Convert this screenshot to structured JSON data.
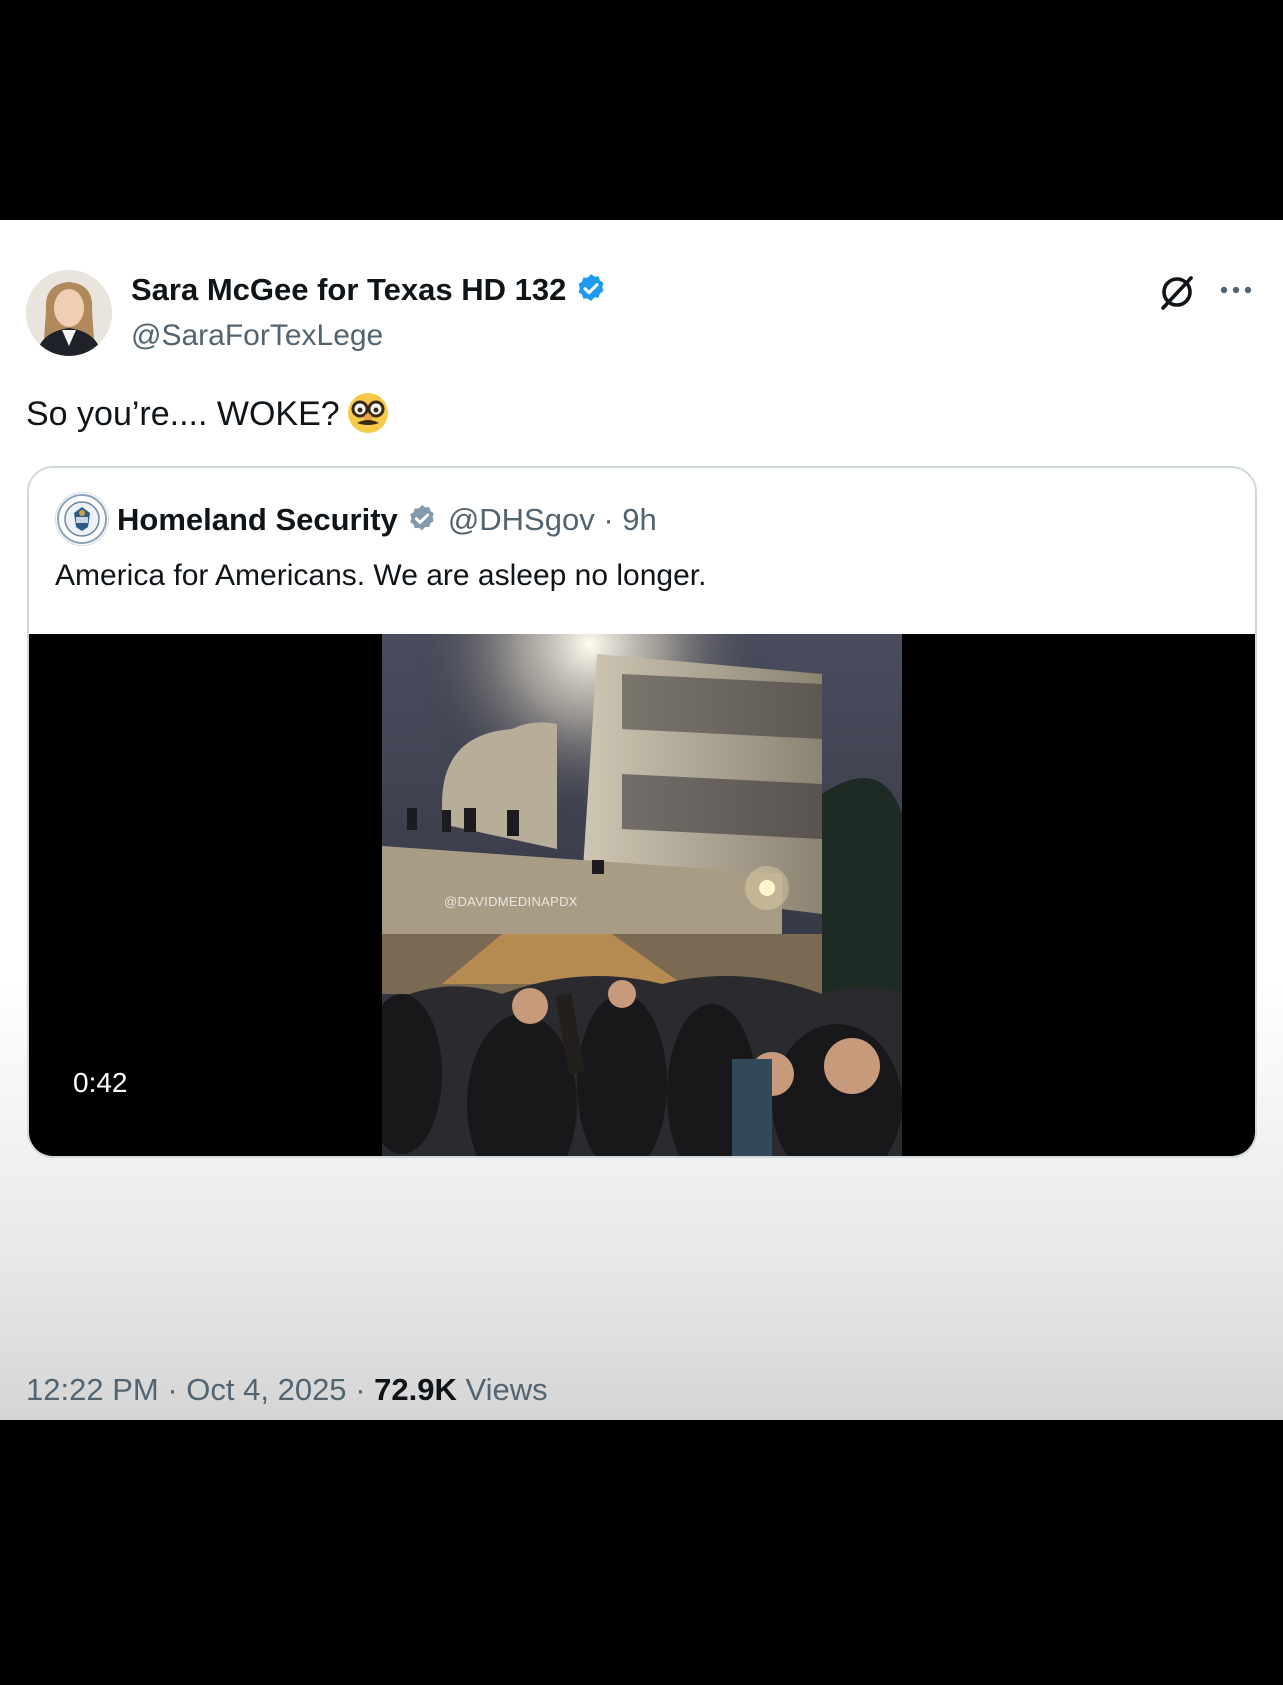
{
  "post": {
    "display_name": "Sara McGee for Texas HD 132",
    "handle": "@SaraForTexLege",
    "text": "So you’re.... WOKE?",
    "emoji": "disguised-face-emoji",
    "verified_color": "#1d9bf0"
  },
  "quoted": {
    "display_name": "Homeland Security",
    "handle": "@DHSgov",
    "separator": "·",
    "age": "9h",
    "text": "America for Americans. We are asleep no longer.",
    "badge_color": "#829aab",
    "video": {
      "watermark": "@DAVIDMEDINAPDX",
      "duration": "0:42"
    }
  },
  "footer": {
    "time": "12:22 PM",
    "separator": "·",
    "date": "Oct 4, 2025",
    "views_count": "72.9K",
    "views_label": "Views"
  },
  "icons": [
    "grok-icon",
    "more-icon",
    "verified-badge-icon",
    "government-badge-icon"
  ]
}
